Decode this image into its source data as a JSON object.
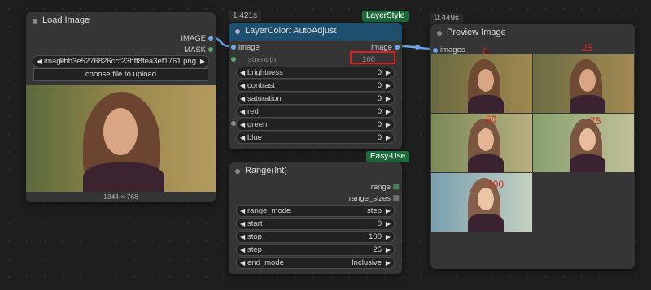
{
  "load_image": {
    "title": "Load Image",
    "out_image": "IMAGE",
    "out_mask": "MASK",
    "file_label": "image",
    "file_name": "0bb3e5276826ccf23bff8fea3ef1761.png",
    "upload_button": "choose file to upload",
    "dims": "1344 × 768"
  },
  "autoadjust": {
    "time": "1.421s",
    "badge": "LayerStyle",
    "title": "LayerColor: AutoAdjust",
    "in_image": "image",
    "out_image": "image",
    "params": [
      {
        "label": "strength",
        "value": "100"
      },
      {
        "label": "brightness",
        "value": "0"
      },
      {
        "label": "contrast",
        "value": "0"
      },
      {
        "label": "saturation",
        "value": "0"
      },
      {
        "label": "red",
        "value": "0"
      },
      {
        "label": "green",
        "value": "0"
      },
      {
        "label": "blue",
        "value": "0"
      }
    ]
  },
  "range": {
    "badge": "Easy-Use",
    "title": "Range(Int)",
    "out_range": "range",
    "out_sizes": "range_sizes",
    "params": [
      {
        "label": "range_mode",
        "value": "step"
      },
      {
        "label": "start",
        "value": "0"
      },
      {
        "label": "stop",
        "value": "100"
      },
      {
        "label": "step",
        "value": "25"
      },
      {
        "label": "end_mode",
        "value": "Inclusive"
      }
    ]
  },
  "preview": {
    "time": "0.449s",
    "title": "Preview Image",
    "in_images": "images",
    "labels": [
      "0",
      "25",
      "50",
      "75",
      "100"
    ]
  },
  "colors": {
    "link": "#6aa8e8",
    "accent_header": "#1f4f6e",
    "badge_green": "#1e6b3c",
    "highlight": "#e02020"
  }
}
